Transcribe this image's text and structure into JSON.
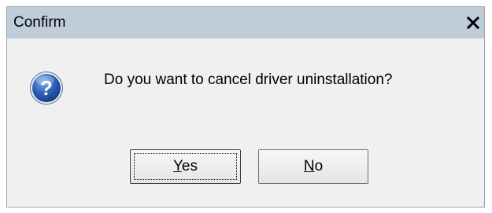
{
  "window": {
    "title": "Confirm",
    "close_icon": "close-icon"
  },
  "message": {
    "icon": "question-icon",
    "text": "Do you want to cancel driver uninstallation?"
  },
  "buttons": {
    "yes": {
      "mnemonic": "Y",
      "rest": "es"
    },
    "no": {
      "mnemonic": "N",
      "rest": "o"
    }
  },
  "colors": {
    "titlebar": "#bfcddb",
    "dialog_bg": "#f0f0f0",
    "icon_blue": "#2f63b8"
  }
}
